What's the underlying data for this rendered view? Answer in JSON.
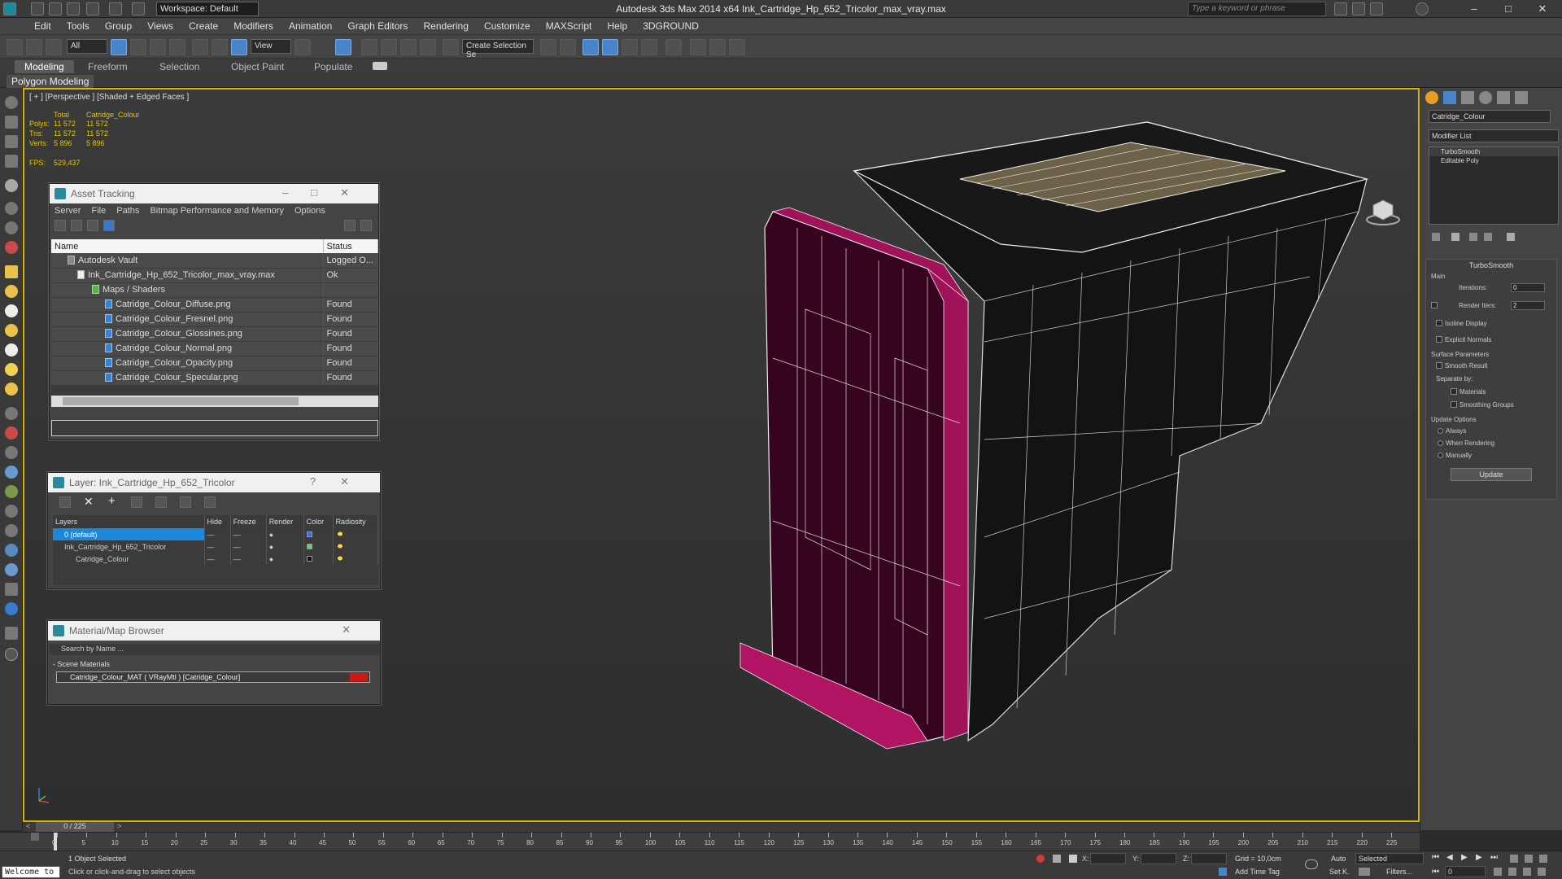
{
  "app": {
    "title": "Autodesk 3ds Max  2014 x64     Ink_Cartridge_Hp_652_Tricolor_max_vray.max",
    "workspace": "Workspace: Default",
    "search_placeholder": "Type a keyword or phrase"
  },
  "menu": [
    "Edit",
    "Tools",
    "Group",
    "Views",
    "Create",
    "Modifiers",
    "Animation",
    "Graph Editors",
    "Rendering",
    "Customize",
    "MAXScript",
    "Help",
    "3DGROUND"
  ],
  "toolbar": {
    "filter": "All",
    "refcoord": "View",
    "selection_set": "Create Selection Se"
  },
  "ribbon": {
    "tabs": [
      "Modeling",
      "Freeform",
      "Selection",
      "Object Paint",
      "Populate"
    ],
    "active": "Modeling",
    "sub_label": "Polygon Modeling"
  },
  "viewport": {
    "label": "[ + ] [Perspective ] [Shaded + Edged Faces ]",
    "stats": {
      "header_total": "Total",
      "header_obj": "Catridge_Colour",
      "rows": [
        {
          "label": "Polys:",
          "total": "11 572",
          "obj": "11 572"
        },
        {
          "label": "Tris:",
          "total": "11 572",
          "obj": "11 572"
        },
        {
          "label": "Verts:",
          "total": "5 896",
          "obj": "5 896"
        }
      ],
      "fps_label": "FPS:",
      "fps": "529,437"
    }
  },
  "asset_tracking": {
    "title": "Asset Tracking",
    "menu": [
      "Server",
      "File",
      "Paths",
      "Bitmap Performance and Memory",
      "Options"
    ],
    "columns": [
      "Name",
      "Status"
    ],
    "rows": [
      {
        "name": "Autodesk Vault",
        "status": "Logged O...",
        "indent": 0
      },
      {
        "name": "Ink_Cartridge_Hp_652_Tricolor_max_vray.max",
        "status": "Ok",
        "indent": 1
      },
      {
        "name": "Maps / Shaders",
        "status": "",
        "indent": 2
      },
      {
        "name": "Catridge_Colour_Diffuse.png",
        "status": "Found",
        "indent": 3
      },
      {
        "name": "Catridge_Colour_Fresnel.png",
        "status": "Found",
        "indent": 3
      },
      {
        "name": "Catridge_Colour_Glossines.png",
        "status": "Found",
        "indent": 3
      },
      {
        "name": "Catridge_Colour_Normal.png",
        "status": "Found",
        "indent": 3
      },
      {
        "name": "Catridge_Colour_Opacity.png",
        "status": "Found",
        "indent": 3
      },
      {
        "name": "Catridge_Colour_Specular.png",
        "status": "Found",
        "indent": 3
      }
    ]
  },
  "layer": {
    "title": "Layer: Ink_Cartridge_Hp_652_Tricolor",
    "columns": [
      "Layers",
      "Hide",
      "Freeze",
      "Render",
      "Color",
      "Radiosity"
    ],
    "rows": [
      {
        "name": "0 (default)",
        "selected": true,
        "color": "#3a6ee0"
      },
      {
        "name": "Ink_Cartridge_Hp_652_Tricolor",
        "selected": false,
        "color": "#5ad07a"
      },
      {
        "name": "Catridge_Colour",
        "selected": false,
        "color": "#111111"
      }
    ]
  },
  "material_browser": {
    "title": "Material/Map Browser",
    "search_placeholder": "Search by Name ...",
    "section": "- Scene Materials",
    "item": "Catridge_Colour_MAT ( VRayMtl ) [Catridge_Colour]"
  },
  "command_panel": {
    "object_name": "Catridge_Colour",
    "modifier_list": "Modifier List",
    "stack": [
      "TurboSmooth",
      "Editable Poly"
    ],
    "rollout_title": "TurboSmooth",
    "main_label": "Main",
    "iterations_label": "Iterations:",
    "iterations": "0",
    "render_iters_label": "Render Iters:",
    "render_iters": "2",
    "isoline": "Isoline Display",
    "explicit": "Explicit Normals",
    "surface_label": "Surface Parameters",
    "smooth_result": "Smooth Result",
    "separate_by": "Separate by:",
    "materials": "Materials",
    "smoothing_groups": "Smoothing Groups",
    "update_label": "Update Options",
    "always": "Always",
    "when_rendering": "When Rendering",
    "manually": "Manually",
    "update_btn": "Update"
  },
  "timeline": {
    "frame": "0 / 225",
    "ticks": [
      "0",
      "5",
      "10",
      "15",
      "20",
      "25",
      "30",
      "35",
      "40",
      "45",
      "50",
      "55",
      "60",
      "65",
      "70",
      "75",
      "80",
      "85",
      "90",
      "95",
      "100",
      "105",
      "110",
      "115",
      "120",
      "125",
      "130",
      "135",
      "140",
      "145",
      "150",
      "155",
      "160",
      "165",
      "170",
      "175",
      "180",
      "185",
      "190",
      "195",
      "200",
      "205",
      "210",
      "215",
      "220",
      "225"
    ]
  },
  "status": {
    "welcome": "Welcome to",
    "selected": "1 Object Selected",
    "hint": "Click or click-and-drag to select objects",
    "x_label": "X:",
    "y_label": "Y:",
    "z_label": "Z:",
    "grid": "Grid = 10,0cm",
    "add_time_tag": "Add Time Tag",
    "auto": "Auto",
    "set_k": "Set K.",
    "selected_dd": "Selected",
    "filters": "Filters...",
    "frame_field": "0"
  },
  "colors": {
    "accent": "#d8b400",
    "selection_blue": "#1e88d8",
    "magenta": "#a0125a"
  }
}
